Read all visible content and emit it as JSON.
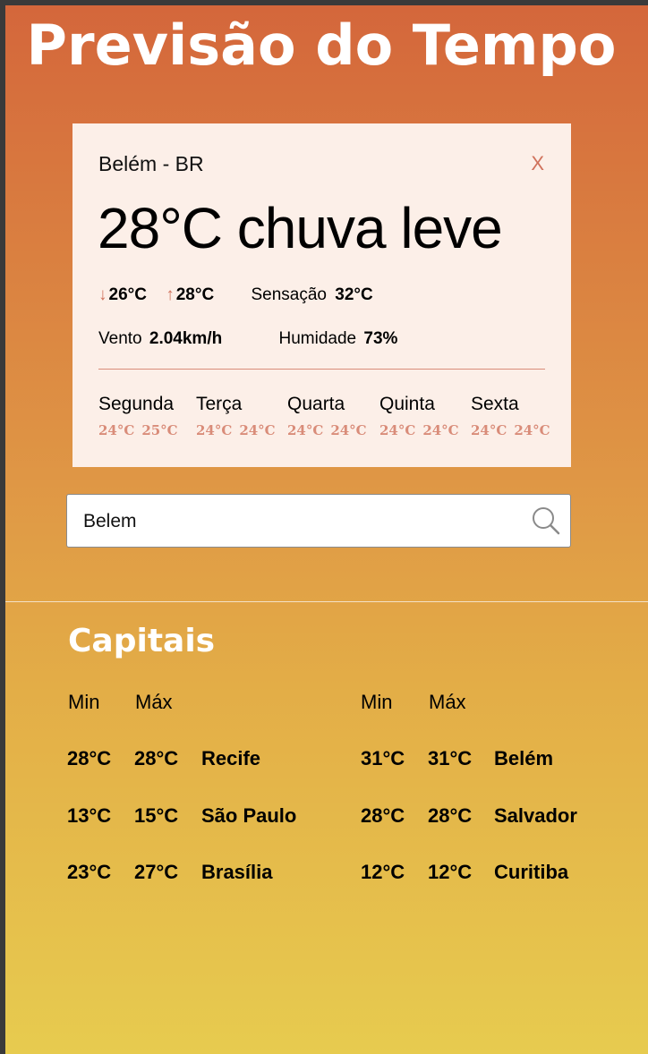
{
  "header": {
    "title": "Previsão do Tempo"
  },
  "card": {
    "city": "Belém - BR",
    "close_label": "X",
    "current": "28°C chuva leve",
    "min": "26°C",
    "max": "28°C",
    "feels_label": "Sensação",
    "feels_value": "32°C",
    "wind_label": "Vento",
    "wind_value": "2.04km/h",
    "humidity_label": "Humidade",
    "humidity_value": "73%",
    "forecast": [
      {
        "day": "Segunda",
        "min": "24°C",
        "max": "25°C"
      },
      {
        "day": "Terça",
        "min": "24°C",
        "max": "24°C"
      },
      {
        "day": "Quarta",
        "min": "24°C",
        "max": "24°C"
      },
      {
        "day": "Quinta",
        "min": "24°C",
        "max": "24°C"
      },
      {
        "day": "Sexta",
        "min": "24°C",
        "max": "24°C"
      }
    ]
  },
  "search": {
    "value": "Belem"
  },
  "capitais": {
    "title": "Capitais",
    "min_header": "Min",
    "max_header": "Máx",
    "left": [
      {
        "min": "28°C",
        "max": "28°C",
        "city": "Recife"
      },
      {
        "min": "13°C",
        "max": "15°C",
        "city": "São Paulo"
      },
      {
        "min": "23°C",
        "max": "27°C",
        "city": "Brasília"
      }
    ],
    "right": [
      {
        "min": "31°C",
        "max": "31°C",
        "city": "Belém"
      },
      {
        "min": "28°C",
        "max": "28°C",
        "city": "Salvador"
      },
      {
        "min": "12°C",
        "max": "12°C",
        "city": "Curitiba"
      }
    ]
  },
  "colors": {
    "accent": "#d0725c",
    "card_bg": "#fcefe8",
    "gradient_top": "#d4663b",
    "gradient_bottom": "#e7cb4f"
  }
}
